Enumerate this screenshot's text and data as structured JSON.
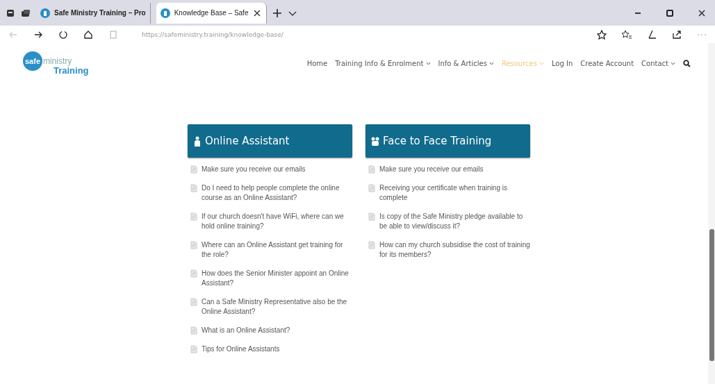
{
  "browser": {
    "tabs": [
      {
        "title": "Safe Ministry Training – Pro",
        "selected": false
      },
      {
        "title": "Knowledge Base – Safe",
        "selected": true
      }
    ],
    "address": "https://safeministry.training/knowledge-base/"
  },
  "site": {
    "logo": {
      "word1": "safe",
      "word2": "ministry",
      "word3": "Training"
    },
    "nav": [
      {
        "label": "Home",
        "dropdown": false,
        "selected": false
      },
      {
        "label": "Training Info & Enrolment",
        "dropdown": true,
        "selected": false
      },
      {
        "label": "Info & Articles",
        "dropdown": true,
        "selected": false
      },
      {
        "label": "Resources",
        "dropdown": true,
        "selected": true
      },
      {
        "label": "Log In",
        "dropdown": false,
        "selected": false
      },
      {
        "label": "Create Account",
        "dropdown": false,
        "selected": false
      },
      {
        "label": "Contact",
        "dropdown": true,
        "selected": false
      }
    ]
  },
  "sections": [
    {
      "title": "Online Assistant",
      "kind": "person",
      "articles": [
        "Make sure you receive our emails",
        "Do I need to help people complete the online course as an Online Assistant?",
        "If our church doesn't have WiFi, where can we hold online training?",
        "Where can an Online Assistant get training for the role?",
        "How does the Senior Minister appoint an Online Assistant?",
        "Can a Safe Ministry Representative also be the Online Assistant?",
        "What is an Online Assistant?",
        "Tips for Online Assistants"
      ]
    },
    {
      "title": "Face to Face Training",
      "kind": "group",
      "articles": [
        "Make sure you receive our emails",
        "Receiving your certificate when training is complete",
        "Is copy of the Safe Ministry pledge available to be able to view/discuss it?",
        "How can my church subsidise the cost of training for its members?"
      ]
    }
  ]
}
